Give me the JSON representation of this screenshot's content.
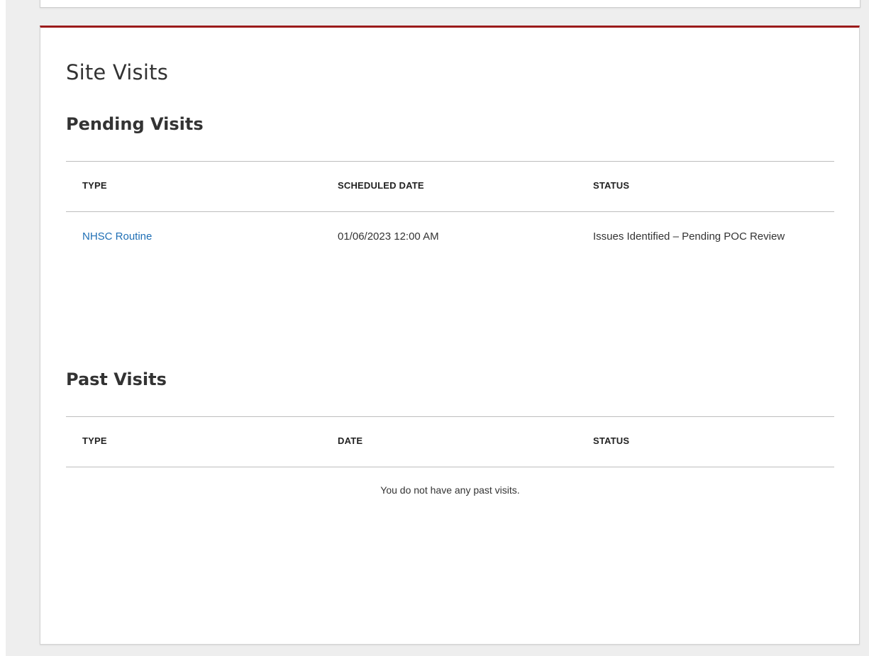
{
  "card": {
    "title": "Site Visits"
  },
  "pending": {
    "title": "Pending Visits",
    "columns": [
      "TYPE",
      "SCHEDULED DATE",
      "STATUS"
    ],
    "rows": [
      {
        "type": "NHSC Routine",
        "scheduled_date": "01/06/2023 12:00 AM",
        "status": "Issues Identified – Pending POC Review"
      }
    ]
  },
  "past": {
    "title": "Past Visits",
    "columns": [
      "TYPE",
      "DATE",
      "STATUS"
    ],
    "empty_message": "You do not have any past visits."
  },
  "colors": {
    "accent": "#9b1b1b",
    "link": "#1f6fb5",
    "page_background": "#eeeeee"
  }
}
